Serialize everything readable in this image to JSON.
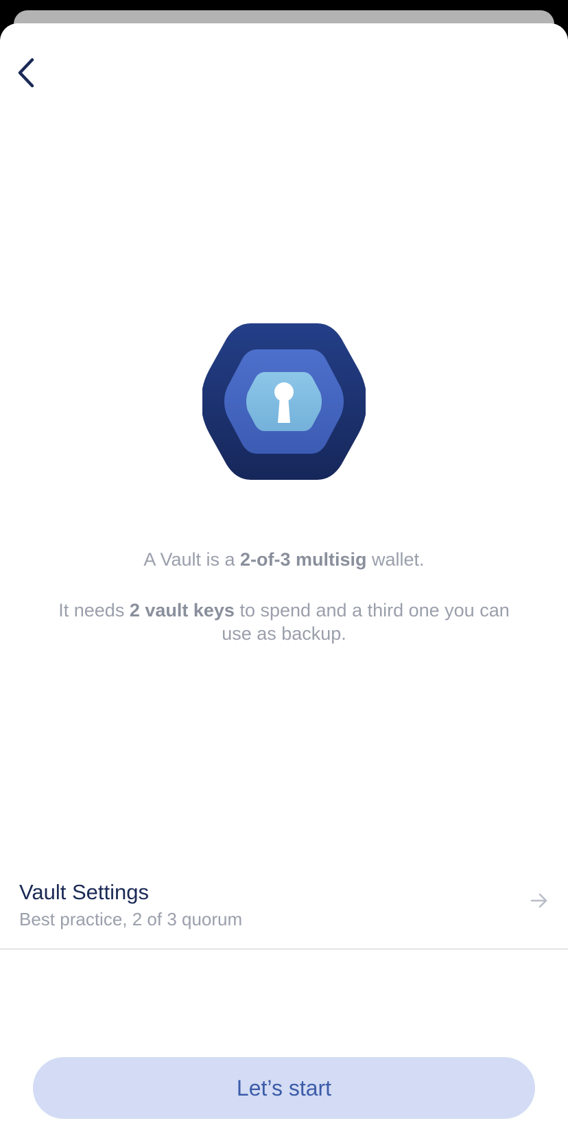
{
  "header": {
    "back_icon": "chevron-left-icon"
  },
  "hero": {
    "icon": "vault-keyhole-icon",
    "colors": {
      "outer": "#1e3472",
      "middle": "#4a6dc9",
      "inner": "#84bde2"
    }
  },
  "description": {
    "line1": {
      "prefix": "A Vault is a ",
      "bold": "2-of-3 multisig",
      "suffix": " wallet."
    },
    "line2": {
      "prefix": "It needs ",
      "bold": "2 vault keys",
      "suffix": " to spend and a third one you can use as backup."
    }
  },
  "vault_settings": {
    "title": "Vault Settings",
    "subtitle": "Best practice, 2 of 3 quorum",
    "arrow_icon": "arrow-right-icon"
  },
  "start_button": {
    "label": "Let’s start",
    "bg_color": "#d3dcf4",
    "text_color": "#3c5ba9"
  }
}
